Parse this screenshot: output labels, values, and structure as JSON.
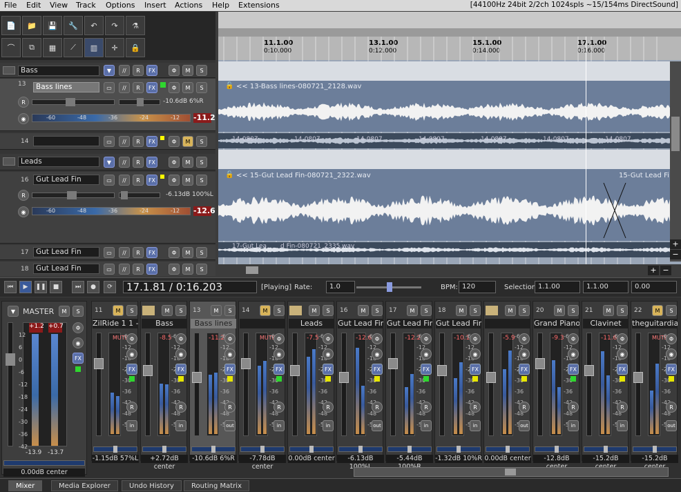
{
  "menu": [
    "File",
    "Edit",
    "View",
    "Track",
    "Options",
    "Insert",
    "Actions",
    "Help",
    "Extensions"
  ],
  "audio_info": "[44100Hz 24bit 2/2ch 1024spls ~15/154ms DirectSound]",
  "ruler": [
    {
      "bar": "11.1.00",
      "time": "0:10.000"
    },
    {
      "bar": "13.1.00",
      "time": "0:12.000"
    },
    {
      "bar": "15.1.00",
      "time": "0:14.000"
    },
    {
      "bar": "17.1.00",
      "time": "0:16.000"
    }
  ],
  "tracks": [
    {
      "num": "",
      "name": "Bass",
      "type": "folder"
    },
    {
      "num": "13",
      "name": "Bass lines",
      "type": "expanded",
      "vol": "-10.6dB 6%R",
      "peak": "-11.2",
      "meter_ticks": [
        "-60",
        "-48",
        "-36",
        "-24",
        "-12"
      ]
    },
    {
      "num": "14",
      "name": "",
      "type": "small"
    },
    {
      "num": "",
      "name": "Leads",
      "type": "folder"
    },
    {
      "num": "16",
      "name": "Gut Lead Fin",
      "type": "expanded",
      "vol": "-6.13dB 100%L",
      "peak": "-12.6",
      "meter_ticks": [
        "-60",
        "-48",
        "-36",
        "-24",
        "-12"
      ]
    },
    {
      "num": "17",
      "name": "Gut Lead Fin",
      "type": "small"
    },
    {
      "num": "18",
      "name": "Gut Lead Fin",
      "type": "small"
    }
  ],
  "items": {
    "bass": "<< 13-Bass lines-080721_2128.wav",
    "lead": "<< 15-Gut Lead Fin-080721_2322.wav",
    "lead2": "15-Gut Lead Fi",
    "small_segments": [
      "14-0807",
      "14-0807",
      "14-0807",
      "14-0807",
      "14-0807",
      "14-0807",
      "14-0807"
    ],
    "small_segments2": [
      "17-Gut Lea",
      "d Fin-080721_2335.wav"
    ]
  },
  "transport": {
    "position": "17.1.81 / 0:16.203",
    "status": "[Playing]",
    "rate_label": "Rate:",
    "rate": "1.0",
    "bpm_label": "BPM:",
    "bpm": "120",
    "selection_label": "Selection:",
    "sel_start": "1.1.00",
    "sel_end": "1.1.00",
    "sel_len": "0.00"
  },
  "master": {
    "label": "MASTER",
    "peak_l": "+1.2",
    "peak_r": "+0.7",
    "bottom_l": "-13.9",
    "bottom_r": "-13.7",
    "pan": "0.00dB center",
    "scale": [
      "12",
      "6",
      "0",
      "-6",
      "-12",
      "-18",
      "-24",
      "-30",
      "-36",
      "-42"
    ]
  },
  "strips": [
    {
      "num": "11",
      "name": "ZilRide 1 1 - R",
      "vol": "",
      "panval": "-1.15dB 57%L",
      "solo": "on",
      "folder": false
    },
    {
      "num": "",
      "name": "Bass",
      "vol": "-8.5",
      "panval": "+2.72dB center",
      "solo": "",
      "folder": true
    },
    {
      "num": "13",
      "name": "Bass lines",
      "vol": "-11.2",
      "panval": "-10.6dB 6%R",
      "solo": "",
      "folder": false,
      "selected": true
    },
    {
      "num": "14",
      "name": "",
      "vol": "",
      "panval": "-7.78dB center",
      "solo": "on",
      "folder": false
    },
    {
      "num": "",
      "name": "Leads",
      "vol": "-7.5",
      "panval": "0.00dB center",
      "solo": "",
      "folder": true
    },
    {
      "num": "16",
      "name": "Gut Lead Fin",
      "vol": "-12.6",
      "panval": "-6.13dB 100%L",
      "solo": "",
      "folder": false
    },
    {
      "num": "17",
      "name": "Gut Lead Fin",
      "vol": "-12.2",
      "panval": "-5.44dB 100%R",
      "solo": "",
      "folder": false
    },
    {
      "num": "18",
      "name": "Gut Lead Fin",
      "vol": "-10.1",
      "panval": "-1.32dB 10%R",
      "solo": "",
      "folder": false
    },
    {
      "num": "",
      "name": "",
      "vol": "-5.9",
      "panval": "0.00dB center",
      "solo": "",
      "folder": true
    },
    {
      "num": "20",
      "name": "Grand Piano",
      "vol": "-9.3",
      "panval": "-12.8dB center",
      "solo": "",
      "folder": false
    },
    {
      "num": "21",
      "name": "Clavinet",
      "vol": "-11.6",
      "panval": "-15.2dB center",
      "solo": "",
      "folder": false
    },
    {
      "num": "22",
      "name": "theguitardia",
      "vol": "",
      "panval": "-15.2dB center",
      "solo": "on",
      "folder": false
    }
  ],
  "strip_scale": [
    "-6",
    "-12",
    "-18",
    "-24",
    "-30",
    "-36",
    "-42",
    "-48",
    "-54"
  ],
  "strip_mute_label": "MUTE",
  "strip_in_label": "in",
  "strip_out_label": "out",
  "tabs": [
    "Mixer",
    "Media Explorer",
    "Undo History",
    "Routing Matrix"
  ],
  "colors": {
    "arrange_bg": "#9aa6b7",
    "item_bg": "#6c7e9a",
    "solo": "#d8b45a",
    "fx": "#5a6fa8",
    "peak": "#8b1a1a"
  }
}
